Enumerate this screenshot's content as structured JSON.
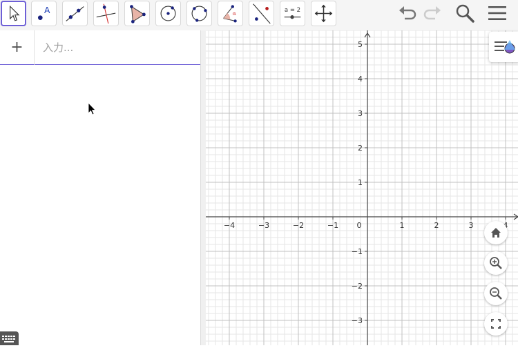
{
  "toolbar": {
    "tools": [
      {
        "name": "move-tool",
        "active": true
      },
      {
        "name": "point-tool",
        "label": "A"
      },
      {
        "name": "line-tool"
      },
      {
        "name": "perpendicular-line-tool"
      },
      {
        "name": "polygon-tool"
      },
      {
        "name": "circle-center-point-tool"
      },
      {
        "name": "circle-three-points-tool"
      },
      {
        "name": "angle-tool",
        "label": "α"
      },
      {
        "name": "reflect-about-line-tool"
      },
      {
        "name": "slider-tool",
        "label": "a = 2"
      },
      {
        "name": "move-graphics-view-tool"
      }
    ],
    "right_icons": [
      "undo-icon",
      "redo-icon",
      "search-icon",
      "menu-icon"
    ]
  },
  "algebra": {
    "add_label": "+",
    "input_placeholder": "入力..."
  },
  "graphics": {
    "x_tick_labels": [
      "−4",
      "−3",
      "−2",
      "−1",
      "0",
      "1",
      "2",
      "3",
      "4"
    ],
    "y_tick_labels": [
      "5",
      "4",
      "3",
      "2",
      "1",
      "−1",
      "−2",
      "−3"
    ],
    "grid": true,
    "axis_color": "#444444",
    "grid_major_color": "#c0c0c0",
    "grid_minor_color": "#e6e6e6",
    "fab_icons": [
      "home-icon",
      "zoom-in-icon",
      "zoom-out-icon",
      "fullscreen-icon"
    ],
    "style_bar_icon": "style-bar-toggle-icon"
  },
  "colors": {
    "accent": "#6d5fd6",
    "point": "#1a237e",
    "polygon_fill": "#e8b4a8",
    "line_red": "#d32f2f"
  }
}
